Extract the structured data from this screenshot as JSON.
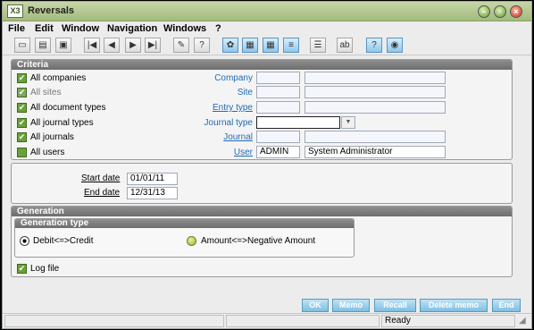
{
  "window": {
    "title": "Reversals",
    "app_icon": "X3"
  },
  "menu": [
    "File",
    "Edit",
    "Window",
    "Navigation",
    "Windows",
    "?"
  ],
  "toolbar": {
    "icons": [
      "new-icon",
      "print-icon",
      "print-preview-icon",
      "first-icon",
      "previous-icon",
      "next-icon",
      "last-icon",
      "attach-icon",
      "help-icon",
      "tree-icon",
      "window-icon",
      "window2-icon",
      "edit-icon",
      "list-icon",
      "text-icon",
      "help-yellow-icon",
      "web-icon"
    ]
  },
  "criteria": {
    "title": "Criteria",
    "checks": [
      {
        "label": "All companies",
        "dim": false
      },
      {
        "label": "All sites",
        "dim": true
      },
      {
        "label": "All document types",
        "dim": false
      },
      {
        "label": "All journal types",
        "dim": false
      },
      {
        "label": "All journals",
        "dim": false
      },
      {
        "label": "All users",
        "dim": false
      }
    ],
    "fields": [
      {
        "label": "Company",
        "underline": false,
        "code": "",
        "desc": ""
      },
      {
        "label": "Site",
        "underline": false,
        "code": "",
        "desc": ""
      },
      {
        "label": "Entry type",
        "underline": true,
        "code": "",
        "desc": ""
      },
      {
        "label": "Journal type",
        "underline": false,
        "code": "",
        "desc": ""
      },
      {
        "label": "Journal",
        "underline": true,
        "code": "",
        "desc": ""
      },
      {
        "label": "User",
        "underline": true,
        "code": "ADMIN",
        "desc": "System Administrator"
      }
    ]
  },
  "dates": {
    "start_label": "Start date",
    "start_value": "01/01/11",
    "end_label": "End date",
    "end_value": "12/31/13"
  },
  "generation": {
    "title": "Generation",
    "type_title": "Generation type",
    "option1": "Debit<=>Credit",
    "option2": "Amount<=>Negative Amount",
    "logfile": "Log file"
  },
  "buttons": {
    "ok": "OK",
    "memo": "Memo",
    "recall": "Recall",
    "delete_memo": "Delete memo",
    "end": "End"
  },
  "status": {
    "text": "Ready"
  },
  "colors": {
    "title_bar": "#a3bb7d",
    "panel_header": "#6d6d6d",
    "button": "#7fbfe0",
    "link": "#1f6bb5",
    "checkbox": "#6aa13a"
  }
}
